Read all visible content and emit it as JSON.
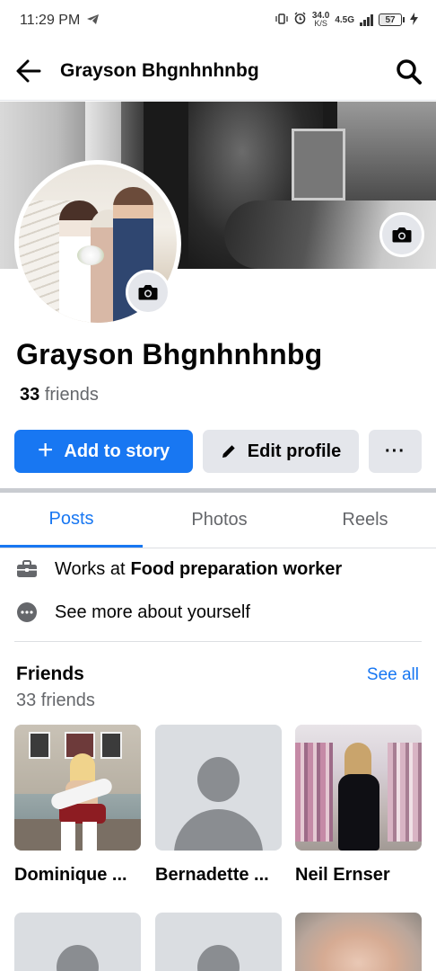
{
  "status_bar": {
    "time": "11:29 PM",
    "net_speed_value": "34.0",
    "net_speed_unit": "K/S",
    "network_type": "4.5G",
    "battery": "57"
  },
  "header": {
    "title": "Grayson Bhgnhnhnbg"
  },
  "profile": {
    "name": "Grayson Bhgnhnhnbg",
    "friends_number": "33",
    "friends_word": "friends"
  },
  "actions": {
    "add_story": "Add to story",
    "edit_profile": "Edit profile",
    "more": "···"
  },
  "tabs": [
    {
      "label": "Posts",
      "active": true
    },
    {
      "label": "Photos",
      "active": false
    },
    {
      "label": "Reels",
      "active": false
    }
  ],
  "details": {
    "work_prefix": "Works at",
    "work_place": "Food preparation worker",
    "see_more": "See more about yourself"
  },
  "friends_section": {
    "title": "Friends",
    "see_all": "See all",
    "subtitle": "33 friends",
    "friends": [
      {
        "name": "Dominique ..."
      },
      {
        "name": "Bernadette ..."
      },
      {
        "name": "Neil Ernser"
      }
    ]
  },
  "colors": {
    "accent": "#1877f2",
    "secondary_button": "#e4e6eb",
    "muted_text": "#65676b"
  }
}
